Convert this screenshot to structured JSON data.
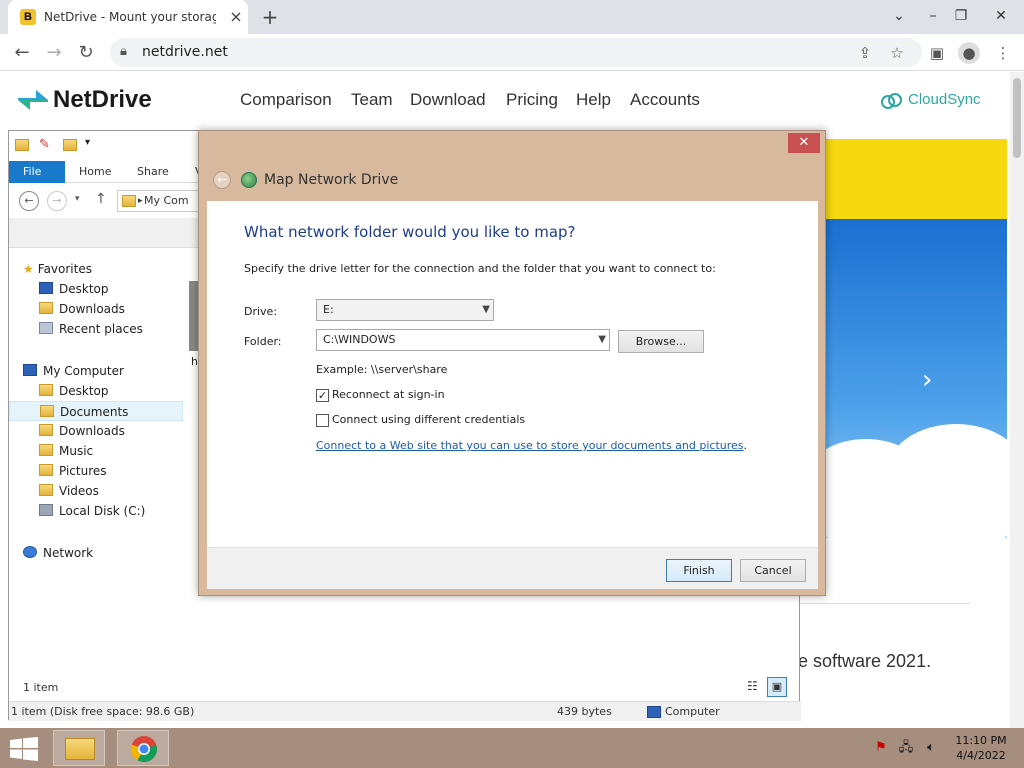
{
  "browser": {
    "tab_title": "NetDrive - Mount your storage a",
    "favicon_letter": "B",
    "url": "netdrive.net"
  },
  "site": {
    "logo_text": "NetDrive",
    "nav": [
      "Comparison",
      "Team",
      "Download",
      "Pricing",
      "Help",
      "Accounts"
    ],
    "cloudsync": "CloudSync",
    "caption": "e software 2021.",
    "accent_color": "#2aa7a0"
  },
  "explorer": {
    "ribbon_tabs": [
      "File",
      "Home",
      "Share",
      "V"
    ],
    "address": "My Com",
    "favorites": {
      "label": "Favorites",
      "items": [
        "Desktop",
        "Downloads",
        "Recent places"
      ]
    },
    "computer": {
      "label": "My Computer",
      "items": [
        "Desktop",
        "Documents",
        "Downloads",
        "Music",
        "Pictures",
        "Videos",
        "Local Disk (C:)"
      ]
    },
    "network": "Network",
    "content_fragment": "h",
    "item_count": "1 item",
    "status_left": "1 item (Disk free space: 98.6 GB)",
    "status_size": "439 bytes",
    "status_location": "Computer"
  },
  "dialog": {
    "title": "Map Network Drive",
    "close_label": "✕",
    "heading": "What network folder would you like to map?",
    "instruction": "Specify the drive letter for the connection and the folder that you want to connect to:",
    "drive_label": "Drive:",
    "drive_value": "E:",
    "folder_label": "Folder:",
    "folder_value": "C:\\WINDOWS",
    "browse_label": "Browse...",
    "example": "Example: \\\\server\\share",
    "reconnect_label": "Reconnect at sign-in",
    "reconnect_checked": true,
    "credentials_label": "Connect using different credentials",
    "credentials_checked": false,
    "web_link": "Connect to a Web site that you can use to store your documents and pictures",
    "finish_label": "Finish",
    "cancel_label": "Cancel"
  },
  "taskbar": {
    "time": "11:10 PM",
    "date": "4/4/2022"
  }
}
